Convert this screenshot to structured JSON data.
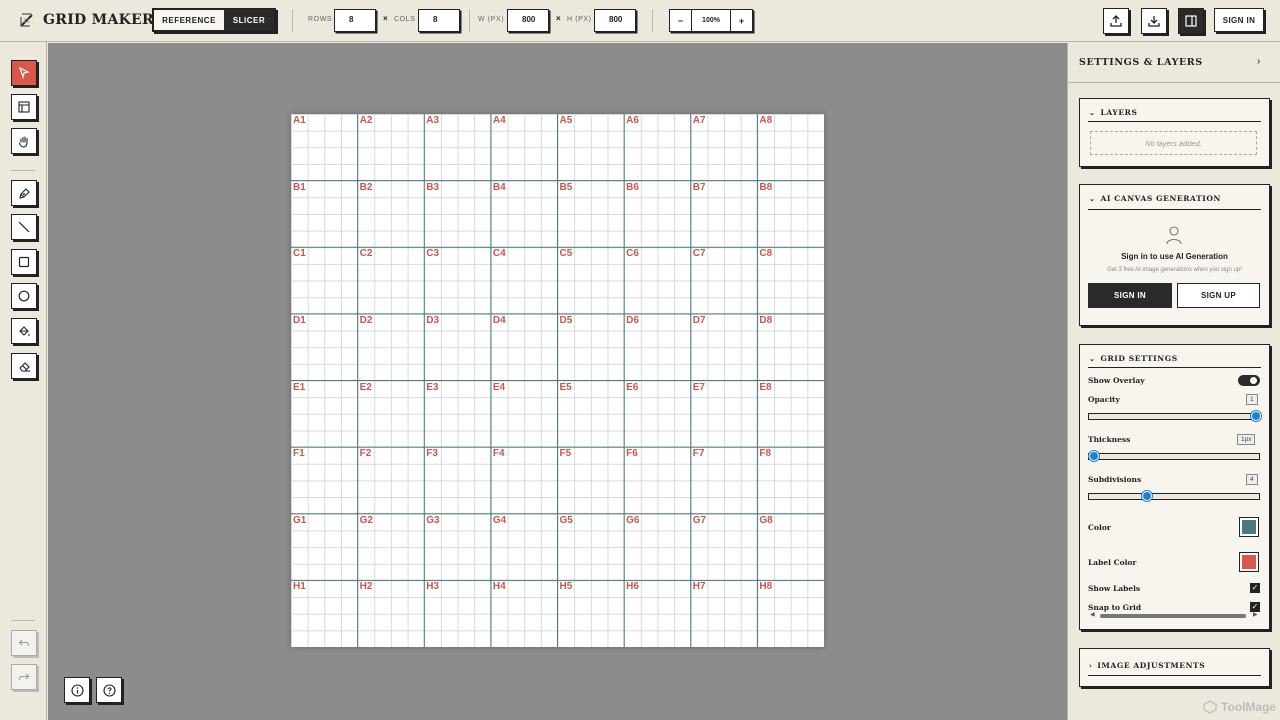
{
  "app": {
    "title": "GRID MAKER",
    "mode_options": [
      "REFERENCE",
      "SLICER"
    ],
    "active_mode": "SLICER"
  },
  "toolbar": {
    "rows_label": "ROWS",
    "rows_value": "8",
    "cols_label": "COLS",
    "cols_value": "8",
    "width_label": "W (PX)",
    "width_value": "800",
    "height_label": "H (PX)",
    "height_value": "800",
    "times_glyph": "×",
    "zoom_out": "−",
    "zoom_value": "100%",
    "zoom_in": "+",
    "sign_in": "SIGN IN"
  },
  "canvas": {
    "row_letters": [
      "A",
      "B",
      "C",
      "D",
      "E",
      "F",
      "G",
      "H"
    ],
    "col_count": 8,
    "subdivisions": 4,
    "grid_color": "#4a7a7c",
    "label_color": "#c9574a"
  },
  "panel": {
    "title": "SETTINGS & LAYERS",
    "layers": {
      "title": "LAYERS",
      "empty": "No layers added."
    },
    "ai": {
      "title": "AI CANVAS GENERATION",
      "heading": "Sign in to use AI Generation",
      "sub": "Get 3 free AI image generations when you sign up!",
      "sign_in": "SIGN IN",
      "sign_up": "SIGN UP"
    },
    "grid_settings": {
      "title": "GRID SETTINGS",
      "show_overlay": "Show Overlay",
      "show_overlay_on": true,
      "opacity_label": "Opacity",
      "opacity_value": "1",
      "opacity_level": 1.0,
      "thickness_label": "Thickness",
      "thickness_value": "1px",
      "thickness_level": 0.0,
      "subdivisions_label": "Subdivisions",
      "subdivisions_value": "4",
      "subdivisions_level": 0.33,
      "color_label": "Color",
      "color_value": "#4a7a7c",
      "label_color_label": "Label Color",
      "label_color_value": "#d9584a",
      "show_labels": "Show Labels",
      "snap_to_grid": "Snap to Grid",
      "check_glyph": "✓"
    },
    "image_adjustments": {
      "title": "IMAGE ADJUSTMENTS"
    }
  },
  "watermark": "ToolMage"
}
